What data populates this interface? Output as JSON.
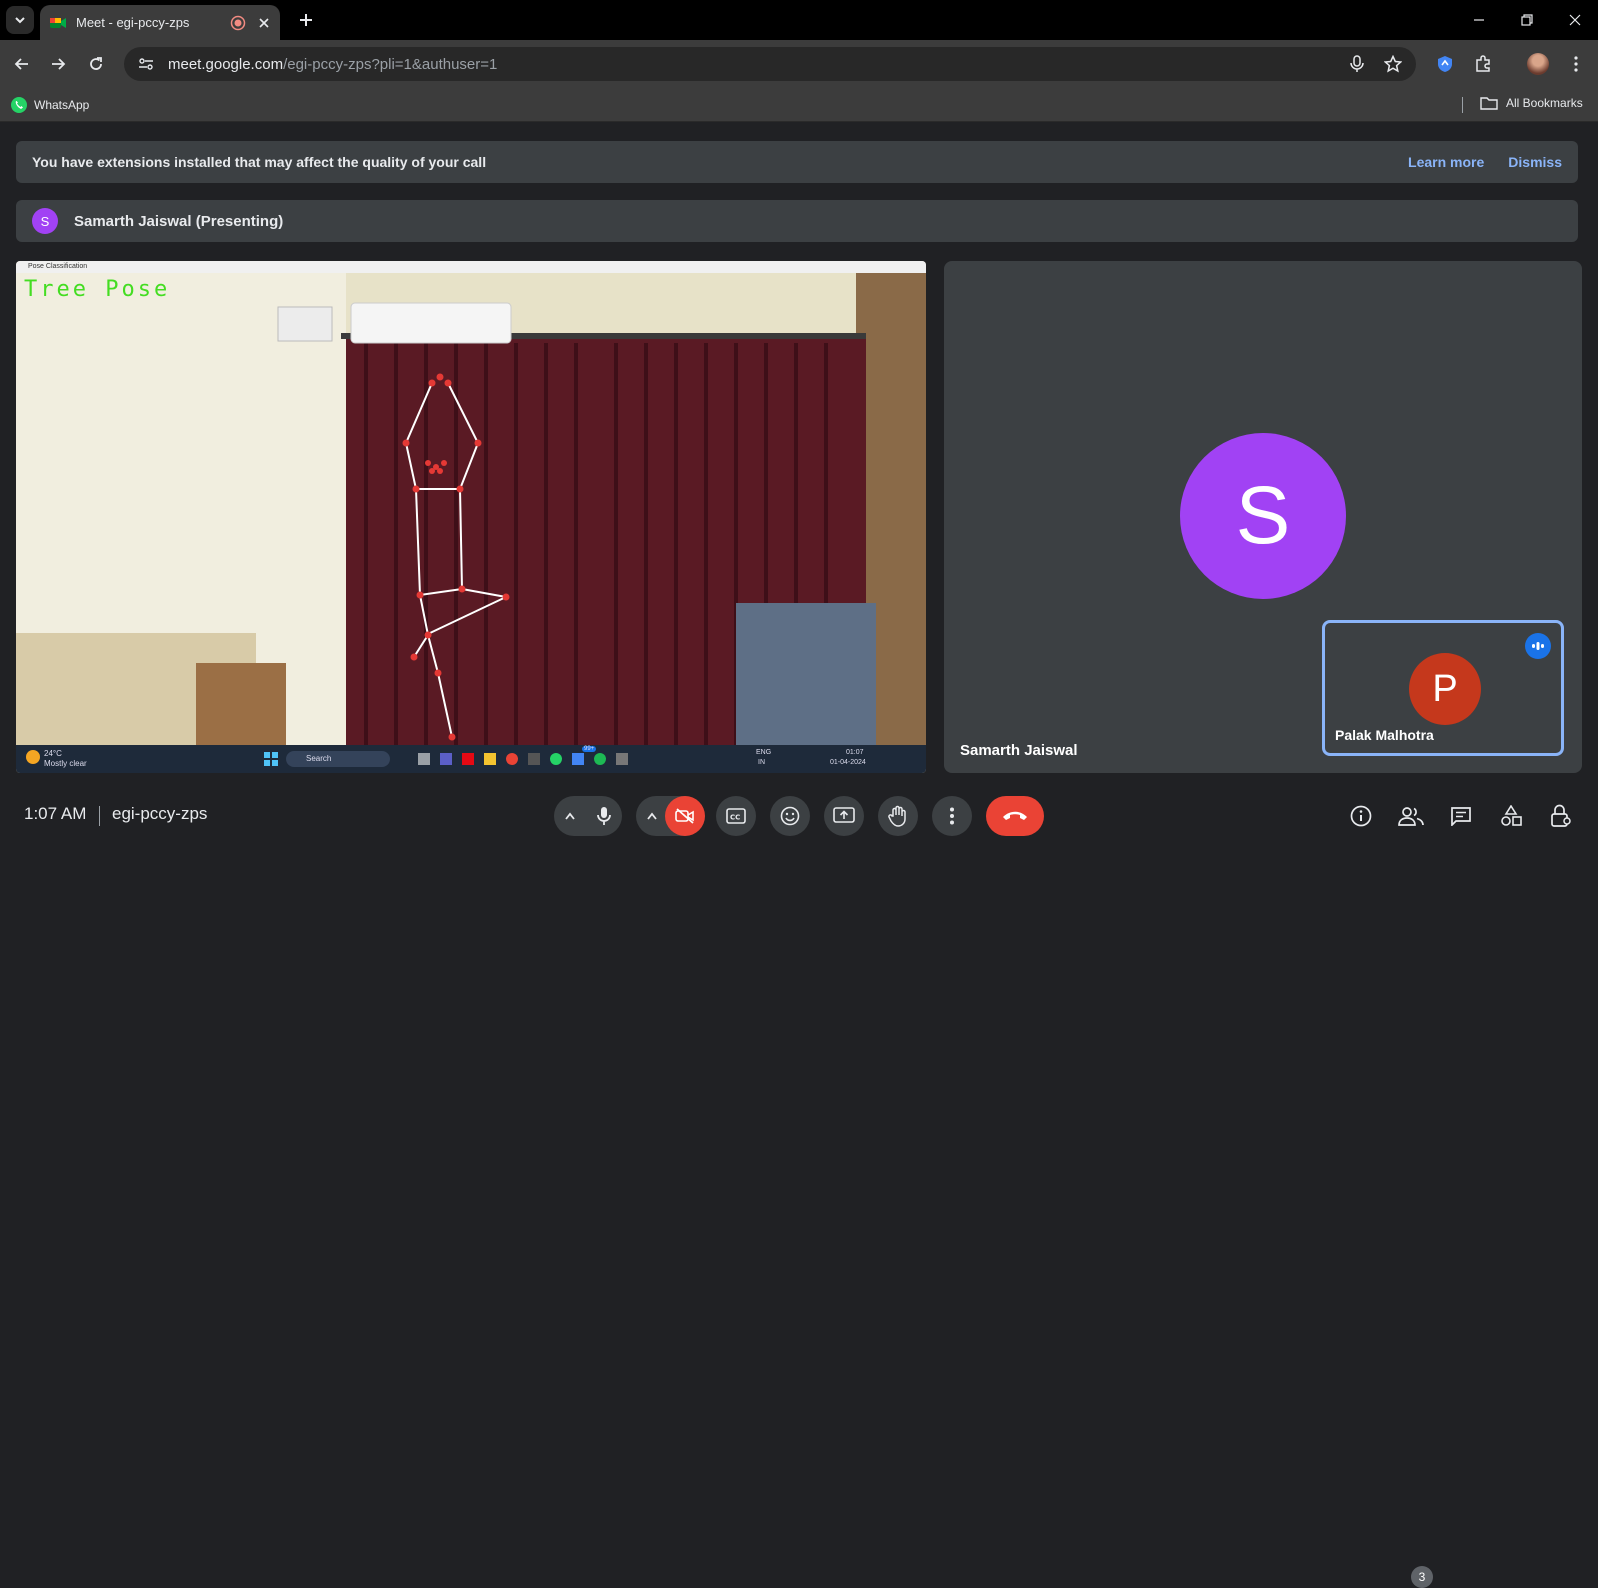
{
  "browser": {
    "tab_title": "Meet - egi-pccy-zps",
    "url_host": "meet.google.com",
    "url_path": "/egi-pccy-zps?pli=1&authuser=1",
    "bookmark_whatsapp": "WhatsApp",
    "all_bookmarks": "All Bookmarks"
  },
  "banner": {
    "message": "You have extensions installed that may affect the quality of your call",
    "learn_more": "Learn more",
    "dismiss": "Dismiss"
  },
  "presenting": {
    "initial": "S",
    "label": "Samarth Jaiswal (Presenting)"
  },
  "shared_screen": {
    "window_title": "Pose Classification",
    "pose_label": "Tree Pose",
    "weather_temp": "24°C",
    "weather_desc": "Mostly clear",
    "search_label": "Search",
    "lang": "ENG",
    "region": "IN",
    "sys_time": "01:07",
    "sys_date": "01-04-2024",
    "notif_count": "99+"
  },
  "tiles": {
    "main_initial": "S",
    "main_name": "Samarth Jaiswal",
    "self_initial": "P",
    "self_name": "Palak Malhotra"
  },
  "bottom": {
    "time": "1:07 AM",
    "meeting_code": "egi-pccy-zps",
    "participants_count": "3"
  },
  "colors": {
    "accent": "#8ab4f8",
    "presenter_avatar": "#a142f4",
    "self_avatar": "#c5381c",
    "end_call": "#ea4335"
  }
}
